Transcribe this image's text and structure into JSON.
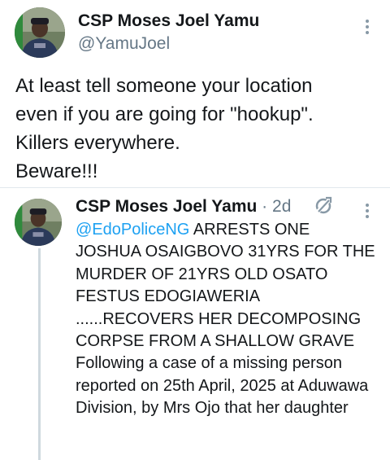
{
  "main_tweet": {
    "author_name": "CSP Moses Joel Yamu",
    "author_handle": "@YamuJoel",
    "text": "At least tell someone your location\neven if you are going for \"hookup\".\nKillers everywhere.\nBeware!!!"
  },
  "quoted_tweet": {
    "author_name": "CSP Moses Joel Yamu",
    "separator": " · ",
    "time": "2d",
    "mention": "@EdoPoliceNG",
    "text": " ARRESTS ONE JOSHUA OSAIGBOVO 31YRS FOR THE MURDER OF 21YRS OLD OSATO FESTUS EDOGIAWERIA ......RECOVERS HER DECOMPOSING CORPSE FROM A SHALLOW GRAVE Following a case of a missing person reported on 25th April, 2025 at Aduwawa Division, by Mrs Ojo that her daughter"
  },
  "icons": {
    "more": "more-vertical-icon",
    "retweet": "retweet-icon"
  },
  "colors": {
    "link": "#1da1f2",
    "secondary_text": "#657786",
    "divider": "#e1e8ed"
  }
}
